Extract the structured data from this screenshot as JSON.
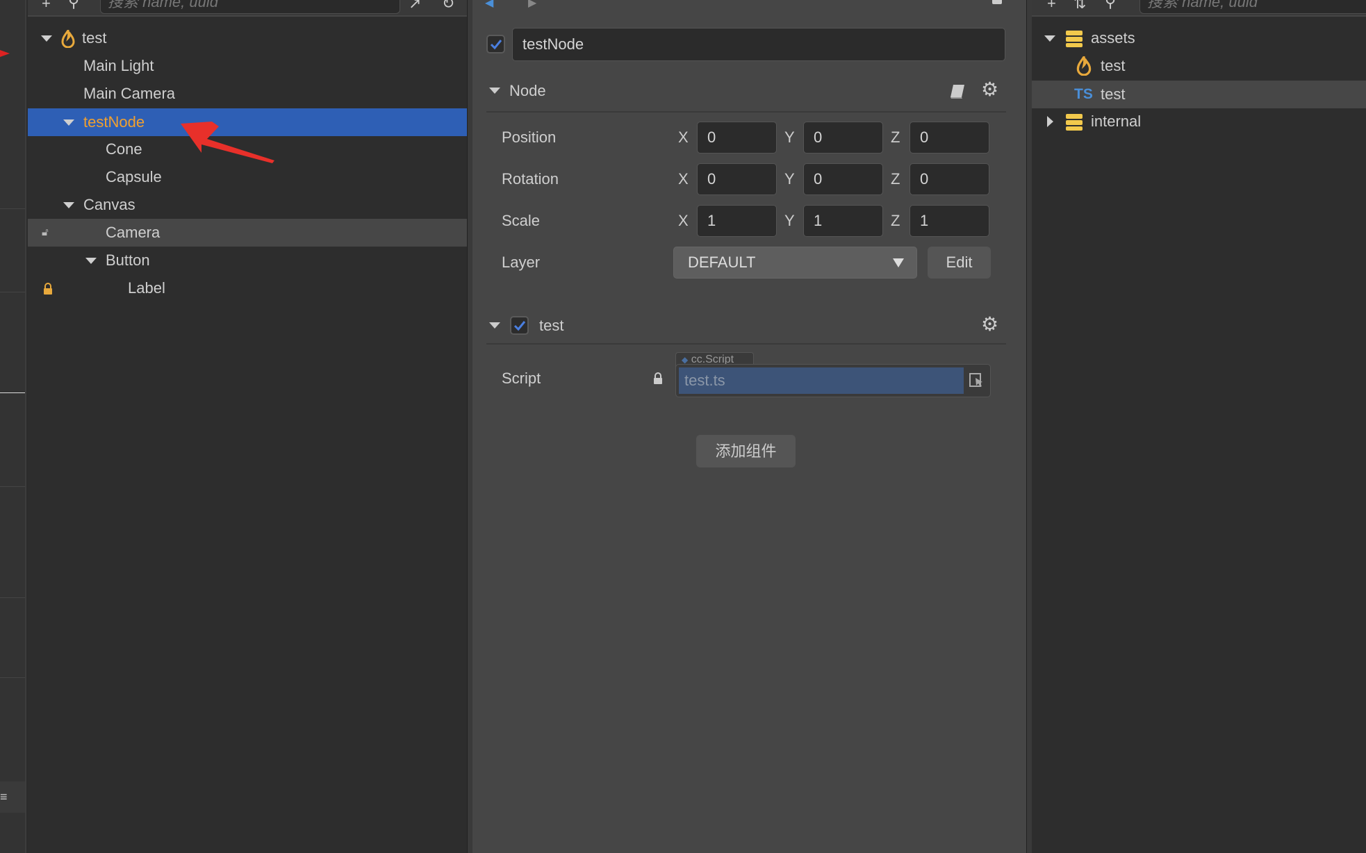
{
  "hierarchy": {
    "search_placeholder": "搜索 name, uuid",
    "items": [
      {
        "label": "test",
        "icon": "scene-flame-icon",
        "expanded": true
      },
      {
        "label": "Main Light"
      },
      {
        "label": "Main Camera"
      },
      {
        "label": "testNode",
        "expanded": true,
        "selected": true
      },
      {
        "label": "Cone"
      },
      {
        "label": "Capsule"
      },
      {
        "label": "Canvas",
        "expanded": true
      },
      {
        "label": "Camera",
        "lock": "unlocked"
      },
      {
        "label": "Button",
        "expanded": true
      },
      {
        "label": "Label",
        "lock": "locked"
      }
    ]
  },
  "inspector": {
    "node_name": "testNode",
    "node_active": true,
    "node_section": "Node",
    "properties": [
      {
        "label": "Position",
        "x": "0",
        "y": "0",
        "z": "0"
      },
      {
        "label": "Rotation",
        "x": "0",
        "y": "0",
        "z": "0"
      },
      {
        "label": "Scale",
        "x": "1",
        "y": "1",
        "z": "1"
      }
    ],
    "axis_labels": {
      "x": "X",
      "y": "Y",
      "z": "Z"
    },
    "layer": {
      "label": "Layer",
      "value": "DEFAULT",
      "edit": "Edit"
    },
    "component": {
      "name": "test",
      "enabled": true,
      "script_label": "Script",
      "script_type": "cc.Script",
      "script_value": "test.ts"
    },
    "add_component": "添加组件"
  },
  "assets": {
    "search_placeholder": "搜索 name, uuid",
    "items": [
      {
        "label": "assets",
        "icon": "database-icon",
        "expanded": true
      },
      {
        "label": "test",
        "icon": "scene-flame-icon"
      },
      {
        "label": "test",
        "icon": "ts",
        "hover": true
      },
      {
        "label": "internal",
        "icon": "database-icon",
        "expanded": false
      }
    ]
  },
  "colors": {
    "selection": "#2e5fb5",
    "selected_text": "#f0a030",
    "accent_blue": "#4a8fd8",
    "folder_yellow": "#f2c94c",
    "arrow_red": "#e8302a"
  }
}
